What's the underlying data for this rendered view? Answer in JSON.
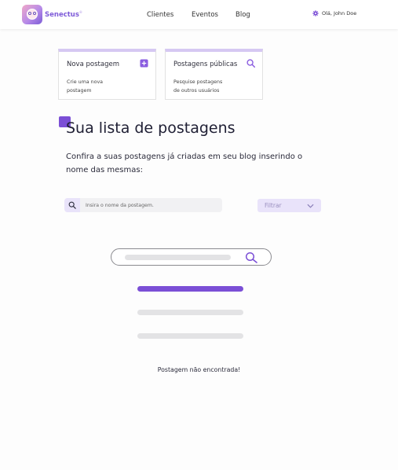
{
  "brand": {
    "name": "Senectus",
    "trademark": "®",
    "accent": "#7b4fd6",
    "light_accent": "#e9e3fa"
  },
  "nav": {
    "items": [
      {
        "label": "Clientes"
      },
      {
        "label": "Eventos"
      },
      {
        "label": "Blog"
      }
    ]
  },
  "user": {
    "greeting": "Olá, John Doe",
    "icon": "gear-icon"
  },
  "cards": [
    {
      "title": "Nova postagem",
      "desc_line1": "Crie uma nova",
      "desc_line2": "postagem",
      "icon": "add-square-icon"
    },
    {
      "title": "Postagens públicas",
      "desc_line1": "Pesquise  postagens",
      "desc_line2": "de outros usuários",
      "icon": "search-icon"
    }
  ],
  "page": {
    "title": "Sua lista de postagens",
    "subtitle": "Confira a suas postagens já criadas em seu blog inserindo o nome das mesmas:"
  },
  "search": {
    "placeholder": "Insira o nome da postagem.",
    "value": ""
  },
  "filter": {
    "label": "Filtrar"
  },
  "empty_state": {
    "message": "Postagem não encontrada!"
  }
}
